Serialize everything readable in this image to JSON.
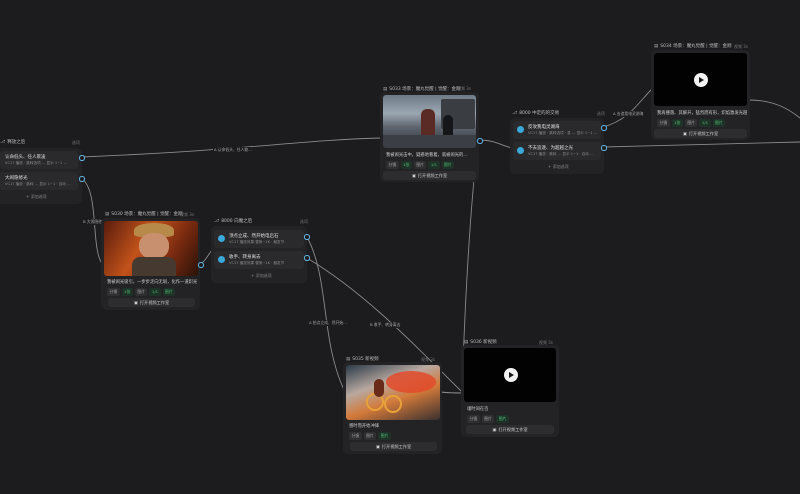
{
  "nodes": {
    "left_choice": {
      "title": "释放之后",
      "tag": "选项",
      "opts": [
        {
          "title": "认命低头、任人欺凌",
          "sub": "VC17 播放 · 跳转选项 …   显示 1~1 …"
        },
        {
          "title": "大闹隐修光",
          "sub": "VC17 播放 · 跳转 …   显示 1~1 · 自动 …"
        }
      ],
      "add": "+ 添加选项"
    },
    "s030": {
      "title": "S030 场景：魔丸觉醒 | 觉醒：金刚",
      "tag": "视频 3s",
      "desc": "我被闹光吸引，一步步走向无垠，化作一道炽光…",
      "chips": [
        "分镜",
        "1张",
        "图片",
        "1/1",
        "图片"
      ],
      "btn": "打开视频工作室"
    },
    "s033": {
      "title": "S033 场景：魔丸觉醒 | 觉醒：金刚",
      "tag": "视频 3s",
      "desc": "我被闹光击中，疑惑地看着，就被闹光的…",
      "chips": [
        "分镜",
        "1张",
        "图片",
        "1/1",
        "图片"
      ],
      "btn": "打开视频工作室"
    },
    "mid_choice": {
      "title": "8000 中定的的交易",
      "tag": "选项",
      "opts": [
        {
          "title": "反攻我电灵湖海",
          "sub": "VC17 播放 · 跳转选项 · 息 …   显示 1~1 …"
        },
        {
          "title": "不去追逐、为超越之光",
          "sub": "VC17 播放 · 跳转 …   显示 1~1 · 自动 …"
        }
      ],
      "add": "+ 添加选项"
    },
    "lower_choice": {
      "title": "8000 向魔之后",
      "tag": "选项",
      "opts": [
        {
          "title": "顶点立成、然开始电启石",
          "sub": "VC17 播放效果   替换~1K · 触发节"
        },
        {
          "title": "收手、转身离去",
          "sub": "VC17 播放效果   替换~1K · 触发节"
        }
      ],
      "add": "+ 添加选项"
    },
    "s034": {
      "title": "S034 场景：魔丸觉醒 | 觉醒：金刚",
      "tag": "视频 3s",
      "desc": "我再撞落、其解开，猛烈而有形，炽焰激发光越…",
      "chips": [
        "分镜",
        "1张",
        "图片",
        "1/1",
        "图片"
      ],
      "btn": "打开视频工作室"
    },
    "s035": {
      "title": "S035 新视频",
      "tag": "视频 3s",
      "desc": "感时而开始冲锋",
      "chips": [
        "分镜",
        "图片",
        "图片"
      ],
      "btn": "打开视频工作室"
    },
    "s036": {
      "title": "S036 新视频",
      "tag": "视频 3s",
      "desc": "魂时间在百",
      "chips": [
        "分镜",
        "图片",
        "图片"
      ],
      "btn": "打开视频工作室"
    }
  },
  "edge_labels": {
    "e1": "A 认命低头、任人欺…",
    "e2": "B 大闹隐修光",
    "e3": "A 去追我电灵湖海",
    "e4": "A 拍点立成、然开始…",
    "e5": "B 收手、转身离去"
  },
  "colors": {
    "background": "#1c1c1e",
    "node": "#232325",
    "port": "#62b6e5",
    "accent_green": "#4ec57a",
    "option_icon": "#3aa8d8"
  }
}
